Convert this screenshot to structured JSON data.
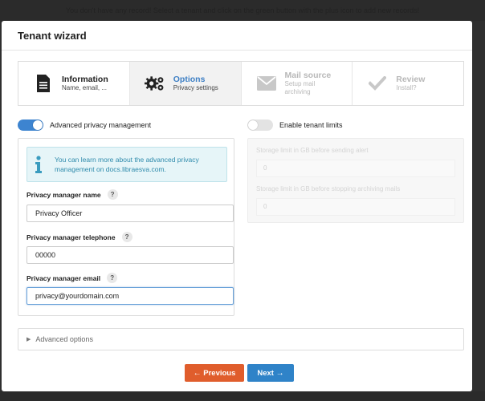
{
  "backdrop_message": "You don't have any record! Select a tenant and click on the green button with the plus icon to add new records!",
  "modal": {
    "title": "Tenant wizard"
  },
  "steps": [
    {
      "title": "Information",
      "subtitle": "Name, email, ...",
      "icon": "document-icon",
      "state": "done"
    },
    {
      "title": "Options",
      "subtitle": "Privacy settings",
      "icon": "gears-icon",
      "state": "active"
    },
    {
      "title": "Mail source",
      "subtitle": "Setup mail archiving",
      "icon": "envelope-icon",
      "state": "disabled"
    },
    {
      "title": "Review",
      "subtitle": "Install?",
      "icon": "checkmark-icon",
      "state": "disabled"
    }
  ],
  "privacy": {
    "toggle_label": "Advanced privacy management",
    "toggle_on": true,
    "info_text_1": "You can learn more about the advanced privacy",
    "info_text_2": "management on docs.libraesva.com.",
    "manager_name_label": "Privacy manager name",
    "manager_name_value": "Privacy Officer",
    "manager_phone_label": "Privacy manager telephone",
    "manager_phone_value": "00000",
    "manager_email_label": "Privacy manager email",
    "manager_email_value": "privacy@yourdomain.com",
    "help_glyph": "?"
  },
  "tenant_limits": {
    "toggle_label": "Enable tenant limits",
    "toggle_on": false,
    "alert_limit_label": "Storage limit in GB before sending alert",
    "alert_limit_value": "0",
    "stop_limit_label": "Storage limit in GB before stopping archiving mails",
    "stop_limit_value": "0"
  },
  "advanced_options": {
    "label": "Advanced options"
  },
  "buttons": {
    "previous": "Previous",
    "next": "Next"
  },
  "colors": {
    "accent": "#3d7fc4",
    "prev": "#e05d2c",
    "next": "#2f83c8",
    "info_bg": "#e6f5f8",
    "info_text": "#2f8bac"
  }
}
